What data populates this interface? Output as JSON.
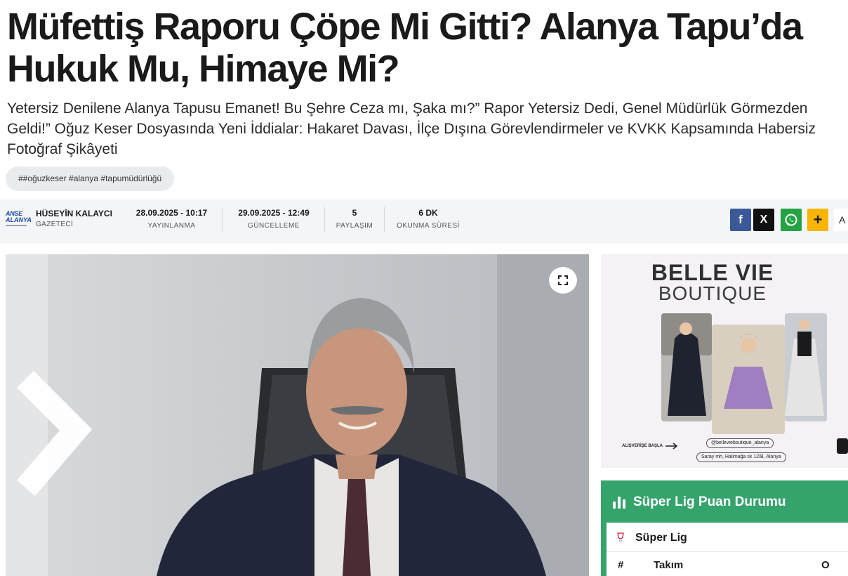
{
  "article": {
    "headline": "Müfettiş Raporu Çöpe Mi Gitti? Alanya Tapu’da Hukuk Mu, Himaye Mi?",
    "subhead": "Yetersiz Denilene Alanya Tapusu Emanet! Bu Şehre Ceza mı, Şaka mı?” Rapor Yetersiz Dedi, Genel Müdürlük Görmezden Geldi!” Oğuz Keser Dosyasında Yeni İddialar: Hakaret Davası, İlçe Dışına Görevlendirmeler ve KVKK Kapsamında Habersiz Fotoğraf Şikâyeti",
    "tags": "##oğuzkeser #alanya #tapumüdürlüğü"
  },
  "meta": {
    "author_logo_line1": "ANSE",
    "author_logo_line2": "ALANYA",
    "author_name": "HÜSEYİN KALAYCI",
    "author_role": "GAZETECİ",
    "published_value": "28.09.2025 - 10:17",
    "published_label": "YAYINLANMA",
    "updated_value": "29.09.2025 - 12:49",
    "updated_label": "GÜNCELLEME",
    "shares_value": "5",
    "shares_label": "PAYLAŞIM",
    "reading_value": "6 DK",
    "reading_label": "OKUNMA SÜRESİ"
  },
  "share": {
    "facebook_glyph": "f",
    "x_glyph": "X",
    "more_glyph": "+",
    "tail_text": "A"
  },
  "ad": {
    "title_line1": "BELLE VIE",
    "title_line2": "BOUTIQUE",
    "cta": "ALIŞVERİŞE BAŞLA",
    "handle": "@bellevieboutique_alanya",
    "address": "Saray mh, Halimağa sk 12/B, Alanya"
  },
  "league": {
    "title": "Süper Lig Puan Durumu",
    "league_name": "Süper Lig",
    "col_rank": "#",
    "col_team": "Takım",
    "col_played": "O"
  },
  "colors": {
    "facebook": "#3b5998",
    "x": "#111111",
    "whatsapp": "#25a244",
    "more": "#f7b500",
    "league_header": "#35a36c"
  }
}
